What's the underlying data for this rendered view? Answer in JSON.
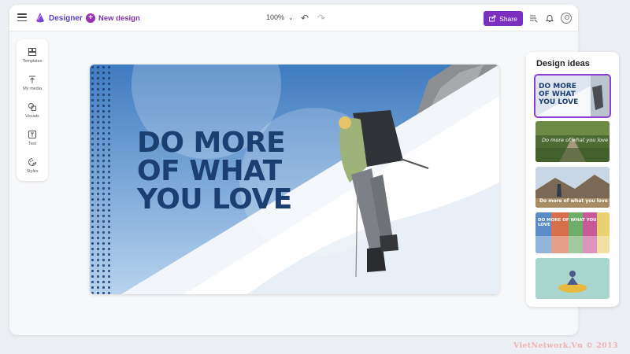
{
  "header": {
    "app_name": "Designer",
    "new_design_label": "New design",
    "zoom_level": "100%",
    "share_label": "Share"
  },
  "tools": [
    {
      "label": "Templates",
      "icon": "templates-icon"
    },
    {
      "label": "My media",
      "icon": "upload-icon"
    },
    {
      "label": "Visuals",
      "icon": "visuals-icon"
    },
    {
      "label": "Text",
      "icon": "text-icon"
    },
    {
      "label": "Styles",
      "icon": "styles-icon"
    }
  ],
  "canvas": {
    "headline_lines": [
      "DO MORE",
      "OF WHAT",
      "YOU LOVE"
    ]
  },
  "design_ideas": {
    "title": "Design ideas",
    "thumbnails": [
      {
        "text_lines": [
          "DO MORE",
          "OF WHAT",
          "YOU LOVE"
        ],
        "selected": true
      },
      {
        "text": "Do more of what you love",
        "selected": false
      },
      {
        "text": "Do more of what you love",
        "selected": false
      },
      {
        "text": "DO MORE OF WHAT YOU LOVE",
        "selected": false
      },
      {
        "text": "",
        "selected": false
      }
    ]
  },
  "watermark": "VietNetwork.Vn © 2013",
  "colors": {
    "accent": "#7b2fbe",
    "brand": "#5b3ec8",
    "headline": "#1c3f72",
    "sky": "#4d86c6"
  }
}
